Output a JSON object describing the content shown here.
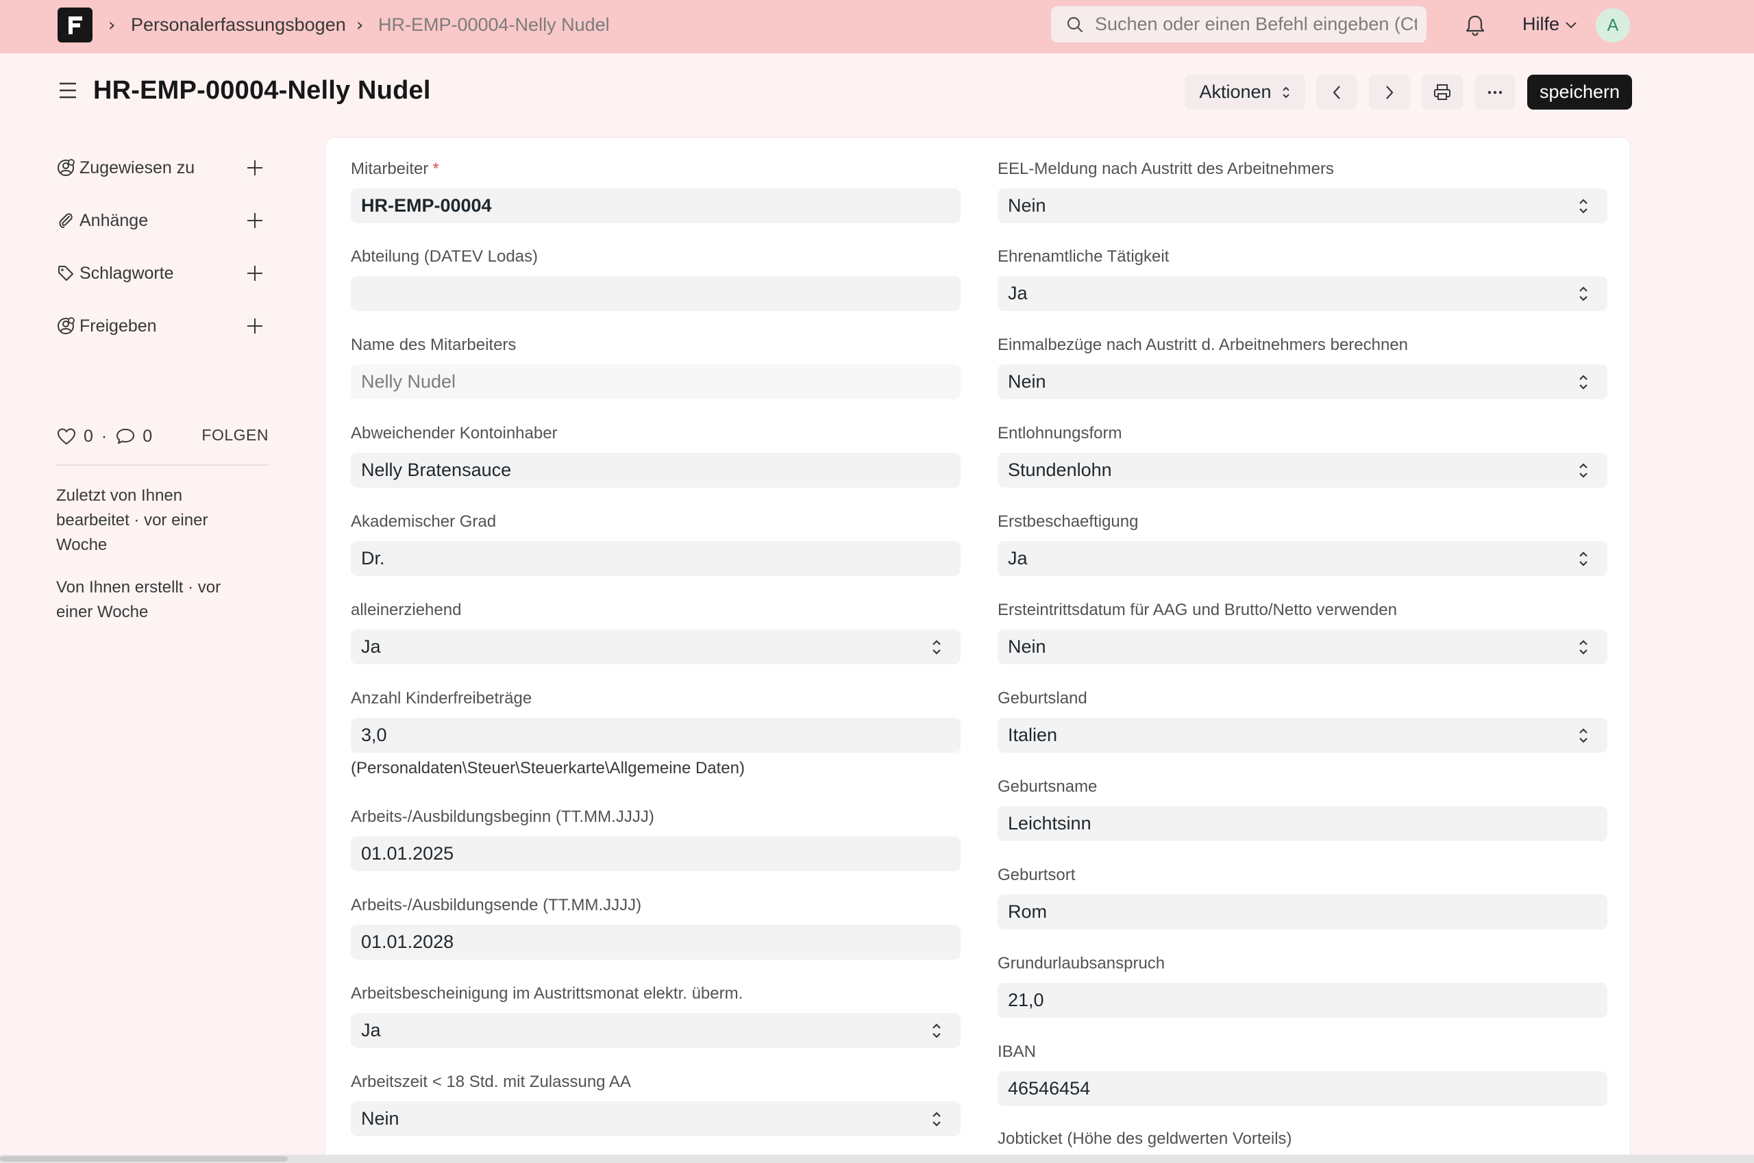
{
  "navbar": {
    "breadcrumbs": [
      "Personalerfassungsbogen",
      "HR-EMP-00004-Nelly Nudel"
    ],
    "search_placeholder": "Suchen oder einen Befehl eingeben (Ctrl+G)",
    "help_label": "Hilfe",
    "avatar_initial": "A"
  },
  "page": {
    "title": "HR-EMP-00004-Nelly Nudel",
    "actions_label": "Aktionen",
    "save_label": "speichern"
  },
  "sidebar": {
    "items": [
      {
        "label": "Zugewiesen zu",
        "icon": "assign-user-icon"
      },
      {
        "label": "Anhänge",
        "icon": "paperclip-icon"
      },
      {
        "label": "Schlagworte",
        "icon": "tag-icon"
      },
      {
        "label": "Freigeben",
        "icon": "share-user-icon"
      }
    ],
    "likes": "0",
    "comments": "0",
    "follow_label": "FOLGEN",
    "last_edited": "Zuletzt von Ihnen bearbeitet · vor einer Woche",
    "created": "Von Ihnen erstellt · vor einer Woche"
  },
  "form": {
    "left": [
      {
        "label": "Mitarbeiter",
        "value": "HR-EMP-00004",
        "required": "*"
      },
      {
        "label": "Abteilung (DATEV Lodas)",
        "value": ""
      },
      {
        "label": "Name des Mitarbeiters",
        "value": "Nelly Nudel"
      },
      {
        "label": "Abweichender Kontoinhaber",
        "value": "Nelly Bratensauce"
      },
      {
        "label": "Akademischer Grad",
        "value": "Dr."
      },
      {
        "label": "alleinerziehend",
        "value": "Ja"
      },
      {
        "label": "Anzahl Kinderfreibeträge",
        "value": "3,0",
        "help": "(Personaldaten\\Steuer\\Steuerkarte\\Allgemeine Daten)"
      },
      {
        "label": "Arbeits-/Ausbildungsbeginn (TT.MM.JJJJ)",
        "value": "01.01.2025"
      },
      {
        "label": "Arbeits-/Ausbildungsende (TT.MM.JJJJ)",
        "value": "01.01.2028"
      },
      {
        "label": "Arbeitsbescheinigung im Austrittsmonat elektr. überm.",
        "value": "Ja"
      },
      {
        "label": "Arbeitszeit < 18 Std. mit Zulassung AA",
        "value": "Nein"
      }
    ],
    "right": [
      {
        "label": "EEL-Meldung nach Austritt des Arbeitnehmers",
        "value": "Nein"
      },
      {
        "label": "Ehrenamtliche Tätigkeit",
        "value": "Ja"
      },
      {
        "label": "Einmalbezüge nach Austritt d. Arbeitnehmers berechnen",
        "value": "Nein"
      },
      {
        "label": "Entlohnungsform",
        "value": "Stundenlohn"
      },
      {
        "label": "Erstbeschaeftigung",
        "value": "Ja"
      },
      {
        "label": "Ersteintrittsdatum für AAG und Brutto/Netto verwenden",
        "value": "Nein"
      },
      {
        "label": "Geburtsland",
        "value": "Italien"
      },
      {
        "label": "Geburtsname",
        "value": "Leichtsinn"
      },
      {
        "label": "Geburtsort",
        "value": "Rom"
      },
      {
        "label": "Grundurlaubsanspruch",
        "value": "21,0"
      },
      {
        "label": "IBAN",
        "value": "46546454"
      },
      {
        "label": "Jobticket (Höhe des geldwerten Vorteils)",
        "value": ""
      }
    ]
  }
}
